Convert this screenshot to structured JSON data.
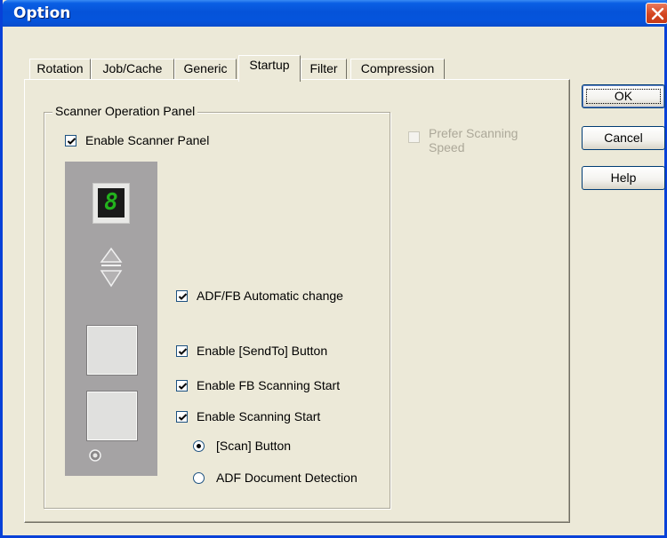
{
  "window": {
    "title": "Option"
  },
  "tabs": [
    {
      "label": "Rotation"
    },
    {
      "label": "Job/Cache"
    },
    {
      "label": "Generic"
    },
    {
      "label": "Startup",
      "active": true
    },
    {
      "label": "Filter"
    },
    {
      "label": "Compression"
    }
  ],
  "buttons": {
    "ok": "OK",
    "cancel": "Cancel",
    "help": "Help"
  },
  "group": {
    "legend": "Scanner Operation Panel",
    "enable_panel": {
      "label": "Enable Scanner Panel",
      "checked": true
    }
  },
  "options": {
    "adf_fb_auto": {
      "label": "ADF/FB Automatic change",
      "checked": true
    },
    "sendto": {
      "label": "Enable [SendTo] Button",
      "checked": true
    },
    "fb_start": {
      "label": "Enable FB Scanning Start",
      "checked": true
    },
    "scan_start": {
      "label": "Enable Scanning Start",
      "checked": true
    },
    "radio_scan_button": {
      "label": "[Scan] Button",
      "selected": true
    },
    "radio_adf_detect": {
      "label": "ADF Document Detection",
      "selected": false
    },
    "prefer_speed": {
      "label_line1": "Prefer Scanning",
      "label_line2": "Speed",
      "checked": false,
      "disabled": true
    }
  },
  "panel_image": {
    "display_digit": "8",
    "display_color": "#23b21d"
  },
  "colors": {
    "title_bar": "#0553d9",
    "dialog_bg": "#ece9d8",
    "close_button": "#d4451f"
  }
}
